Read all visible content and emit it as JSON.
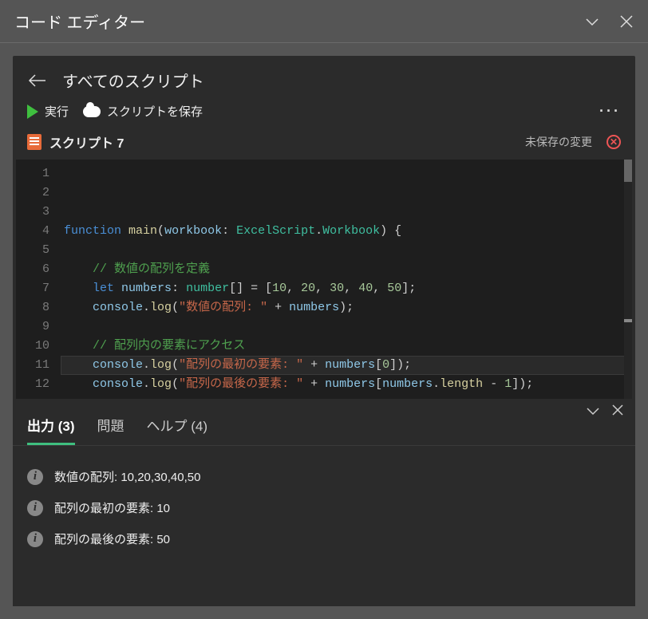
{
  "titlebar": {
    "title": "コード エディター"
  },
  "nav": {
    "breadcrumb": "すべてのスクリプト"
  },
  "toolbar": {
    "run_label": "実行",
    "save_label": "スクリプトを保存",
    "more": "···"
  },
  "script": {
    "name": "スクリプト 7",
    "unsaved_label": "未保存の変更"
  },
  "code": {
    "lines": [
      {
        "n": "1",
        "tokens": [
          [
            "kw",
            "function"
          ],
          [
            "punc",
            " "
          ],
          [
            "fn",
            "main"
          ],
          [
            "punc",
            "("
          ],
          [
            "id",
            "workbook"
          ],
          [
            "punc",
            ": "
          ],
          [
            "type",
            "ExcelScript"
          ],
          [
            "punc",
            "."
          ],
          [
            "type",
            "Workbook"
          ],
          [
            "punc",
            ") {"
          ]
        ]
      },
      {
        "n": "2",
        "tokens": []
      },
      {
        "n": "3",
        "tokens": [
          [
            "punc",
            "    "
          ],
          [
            "cmt",
            "// 数値の配列を定義"
          ]
        ]
      },
      {
        "n": "4",
        "tokens": [
          [
            "punc",
            "    "
          ],
          [
            "kw",
            "let"
          ],
          [
            "punc",
            " "
          ],
          [
            "id",
            "numbers"
          ],
          [
            "punc",
            ": "
          ],
          [
            "type",
            "number"
          ],
          [
            "punc",
            "[] = ["
          ],
          [
            "num",
            "10"
          ],
          [
            "punc",
            ", "
          ],
          [
            "num",
            "20"
          ],
          [
            "punc",
            ", "
          ],
          [
            "num",
            "30"
          ],
          [
            "punc",
            ", "
          ],
          [
            "num",
            "40"
          ],
          [
            "punc",
            ", "
          ],
          [
            "num",
            "50"
          ],
          [
            "punc",
            "];"
          ]
        ]
      },
      {
        "n": "5",
        "tokens": [
          [
            "punc",
            "    "
          ],
          [
            "id",
            "console"
          ],
          [
            "punc",
            "."
          ],
          [
            "prop",
            "log"
          ],
          [
            "punc",
            "("
          ],
          [
            "str",
            "\"数値の配列: \""
          ],
          [
            "punc",
            " + "
          ],
          [
            "id",
            "numbers"
          ],
          [
            "punc",
            ");"
          ]
        ]
      },
      {
        "n": "6",
        "tokens": []
      },
      {
        "n": "7",
        "tokens": [
          [
            "punc",
            "    "
          ],
          [
            "cmt",
            "// 配列内の要素にアクセス"
          ]
        ]
      },
      {
        "n": "8",
        "tokens": [
          [
            "punc",
            "    "
          ],
          [
            "id",
            "console"
          ],
          [
            "punc",
            "."
          ],
          [
            "prop",
            "log"
          ],
          [
            "punc",
            "("
          ],
          [
            "str",
            "\"配列の最初の要素: \""
          ],
          [
            "punc",
            " + "
          ],
          [
            "id",
            "numbers"
          ],
          [
            "punc",
            "["
          ],
          [
            "num",
            "0"
          ],
          [
            "punc",
            "]);"
          ]
        ]
      },
      {
        "n": "9",
        "tokens": [
          [
            "punc",
            "    "
          ],
          [
            "id",
            "console"
          ],
          [
            "punc",
            "."
          ],
          [
            "prop",
            "log"
          ],
          [
            "punc",
            "("
          ],
          [
            "str",
            "\"配列の最後の要素: \""
          ],
          [
            "punc",
            " + "
          ],
          [
            "id",
            "numbers"
          ],
          [
            "punc",
            "["
          ],
          [
            "id",
            "numbers"
          ],
          [
            "punc",
            "."
          ],
          [
            "prop",
            "length"
          ],
          [
            "punc",
            " - "
          ],
          [
            "num",
            "1"
          ],
          [
            "punc",
            "]);"
          ]
        ]
      },
      {
        "n": "10",
        "tokens": []
      },
      {
        "n": "11",
        "tokens": [
          [
            "punc",
            "}"
          ]
        ]
      },
      {
        "n": "12",
        "tokens": []
      }
    ],
    "highlight_line": 11
  },
  "bottom_tabs": {
    "output": {
      "label": "出力",
      "count": 3
    },
    "problems": {
      "label": "問題"
    },
    "help": {
      "label": "ヘルプ",
      "count": 4
    }
  },
  "output": {
    "lines": [
      "数値の配列: 10,20,30,40,50",
      "配列の最初の要素: 10",
      "配列の最後の要素: 50"
    ]
  }
}
